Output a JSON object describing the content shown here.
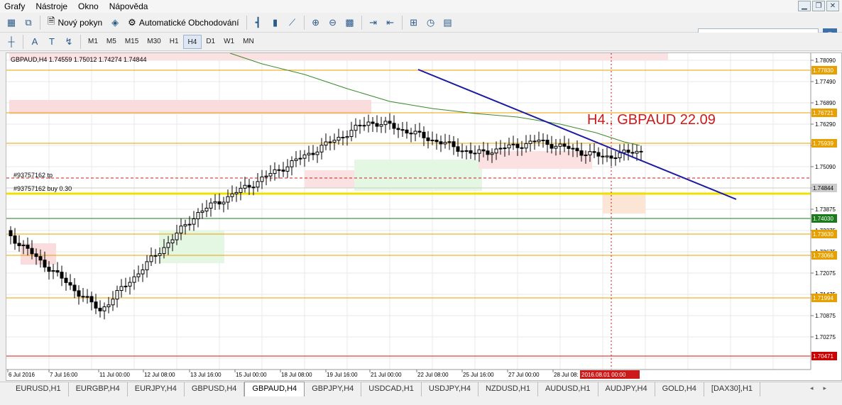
{
  "menu": [
    "Grafy",
    "Nástroje",
    "Okno",
    "Nápověda"
  ],
  "toolbar": {
    "new_order": "Nový pokyn",
    "autotrading": "Automatické Obchodování"
  },
  "timeframes": [
    "M1",
    "M5",
    "M15",
    "M30",
    "H1",
    "H4",
    "D1",
    "W1",
    "MN"
  ],
  "selected_timeframe": "H4",
  "help_label": "5",
  "chart": {
    "header": "GBPAUD,H4  1.74559 1.75012 1.74274 1.74844",
    "annotation": "H4.. GBPAUD 22.09",
    "tp_label": "#93757162 tp",
    "buy_label": "#93757162 buy 0.30",
    "price_scale": [
      "1.78090",
      "1.77490",
      "1.76890",
      "1.76290",
      "1.75690",
      "1.75090",
      "1.74490",
      "1.73875",
      "1.73275",
      "1.72675",
      "1.72075",
      "1.71475",
      "1.70875",
      "1.70275"
    ],
    "level_labels": [
      {
        "text": "1.77830",
        "color": "#e8a000"
      },
      {
        "text": "1.76721",
        "color": "#e8a000"
      },
      {
        "text": "1.75939",
        "color": "#e8a000"
      },
      {
        "text": "1.74844",
        "color": "#cccccc"
      },
      {
        "text": "1.74030",
        "color": "#1c7a1c"
      },
      {
        "text": "1.73630",
        "color": "#e8a000"
      },
      {
        "text": "1.73066",
        "color": "#e8a000"
      },
      {
        "text": "1.71994",
        "color": "#e8a000"
      },
      {
        "text": "1.70471",
        "color": "#cc0000"
      }
    ],
    "time_labels": [
      "6 Jul 2016",
      "7 Jul 16:00",
      "11 Jul 00:00",
      "12 Jul 08:00",
      "13 Jul 16:00",
      "15 Jul 00:00",
      "18 Jul 08:00",
      "19 Jul 16:00",
      "21 Jul 00:00",
      "22 Jul 08:00",
      "25 Jul 16:00",
      "27 Jul 00:00",
      "28 Jul 08:"
    ],
    "cursor_time": "2016.08.01 00:00"
  },
  "tabs": [
    "EURUSD,H1",
    "EURGBP,H4",
    "EURJPY,H4",
    "GBPUSD,H4",
    "GBPAUD,H4",
    "GBPJPY,H4",
    "USDCAD,H1",
    "USDJPY,H4",
    "NZDUSD,H1",
    "AUDUSD,H1",
    "AUDJPY,H4",
    "GOLD,H4",
    "[DAX30],H1"
  ],
  "selected_tab": "GBPAUD,H4",
  "colors": {
    "bull": "#ffffff",
    "bear": "#000000",
    "trendline": "#1a1aa0",
    "ma": "#3a8a2a",
    "annotation": "#cc1a1a",
    "level": "#e8a000"
  }
}
